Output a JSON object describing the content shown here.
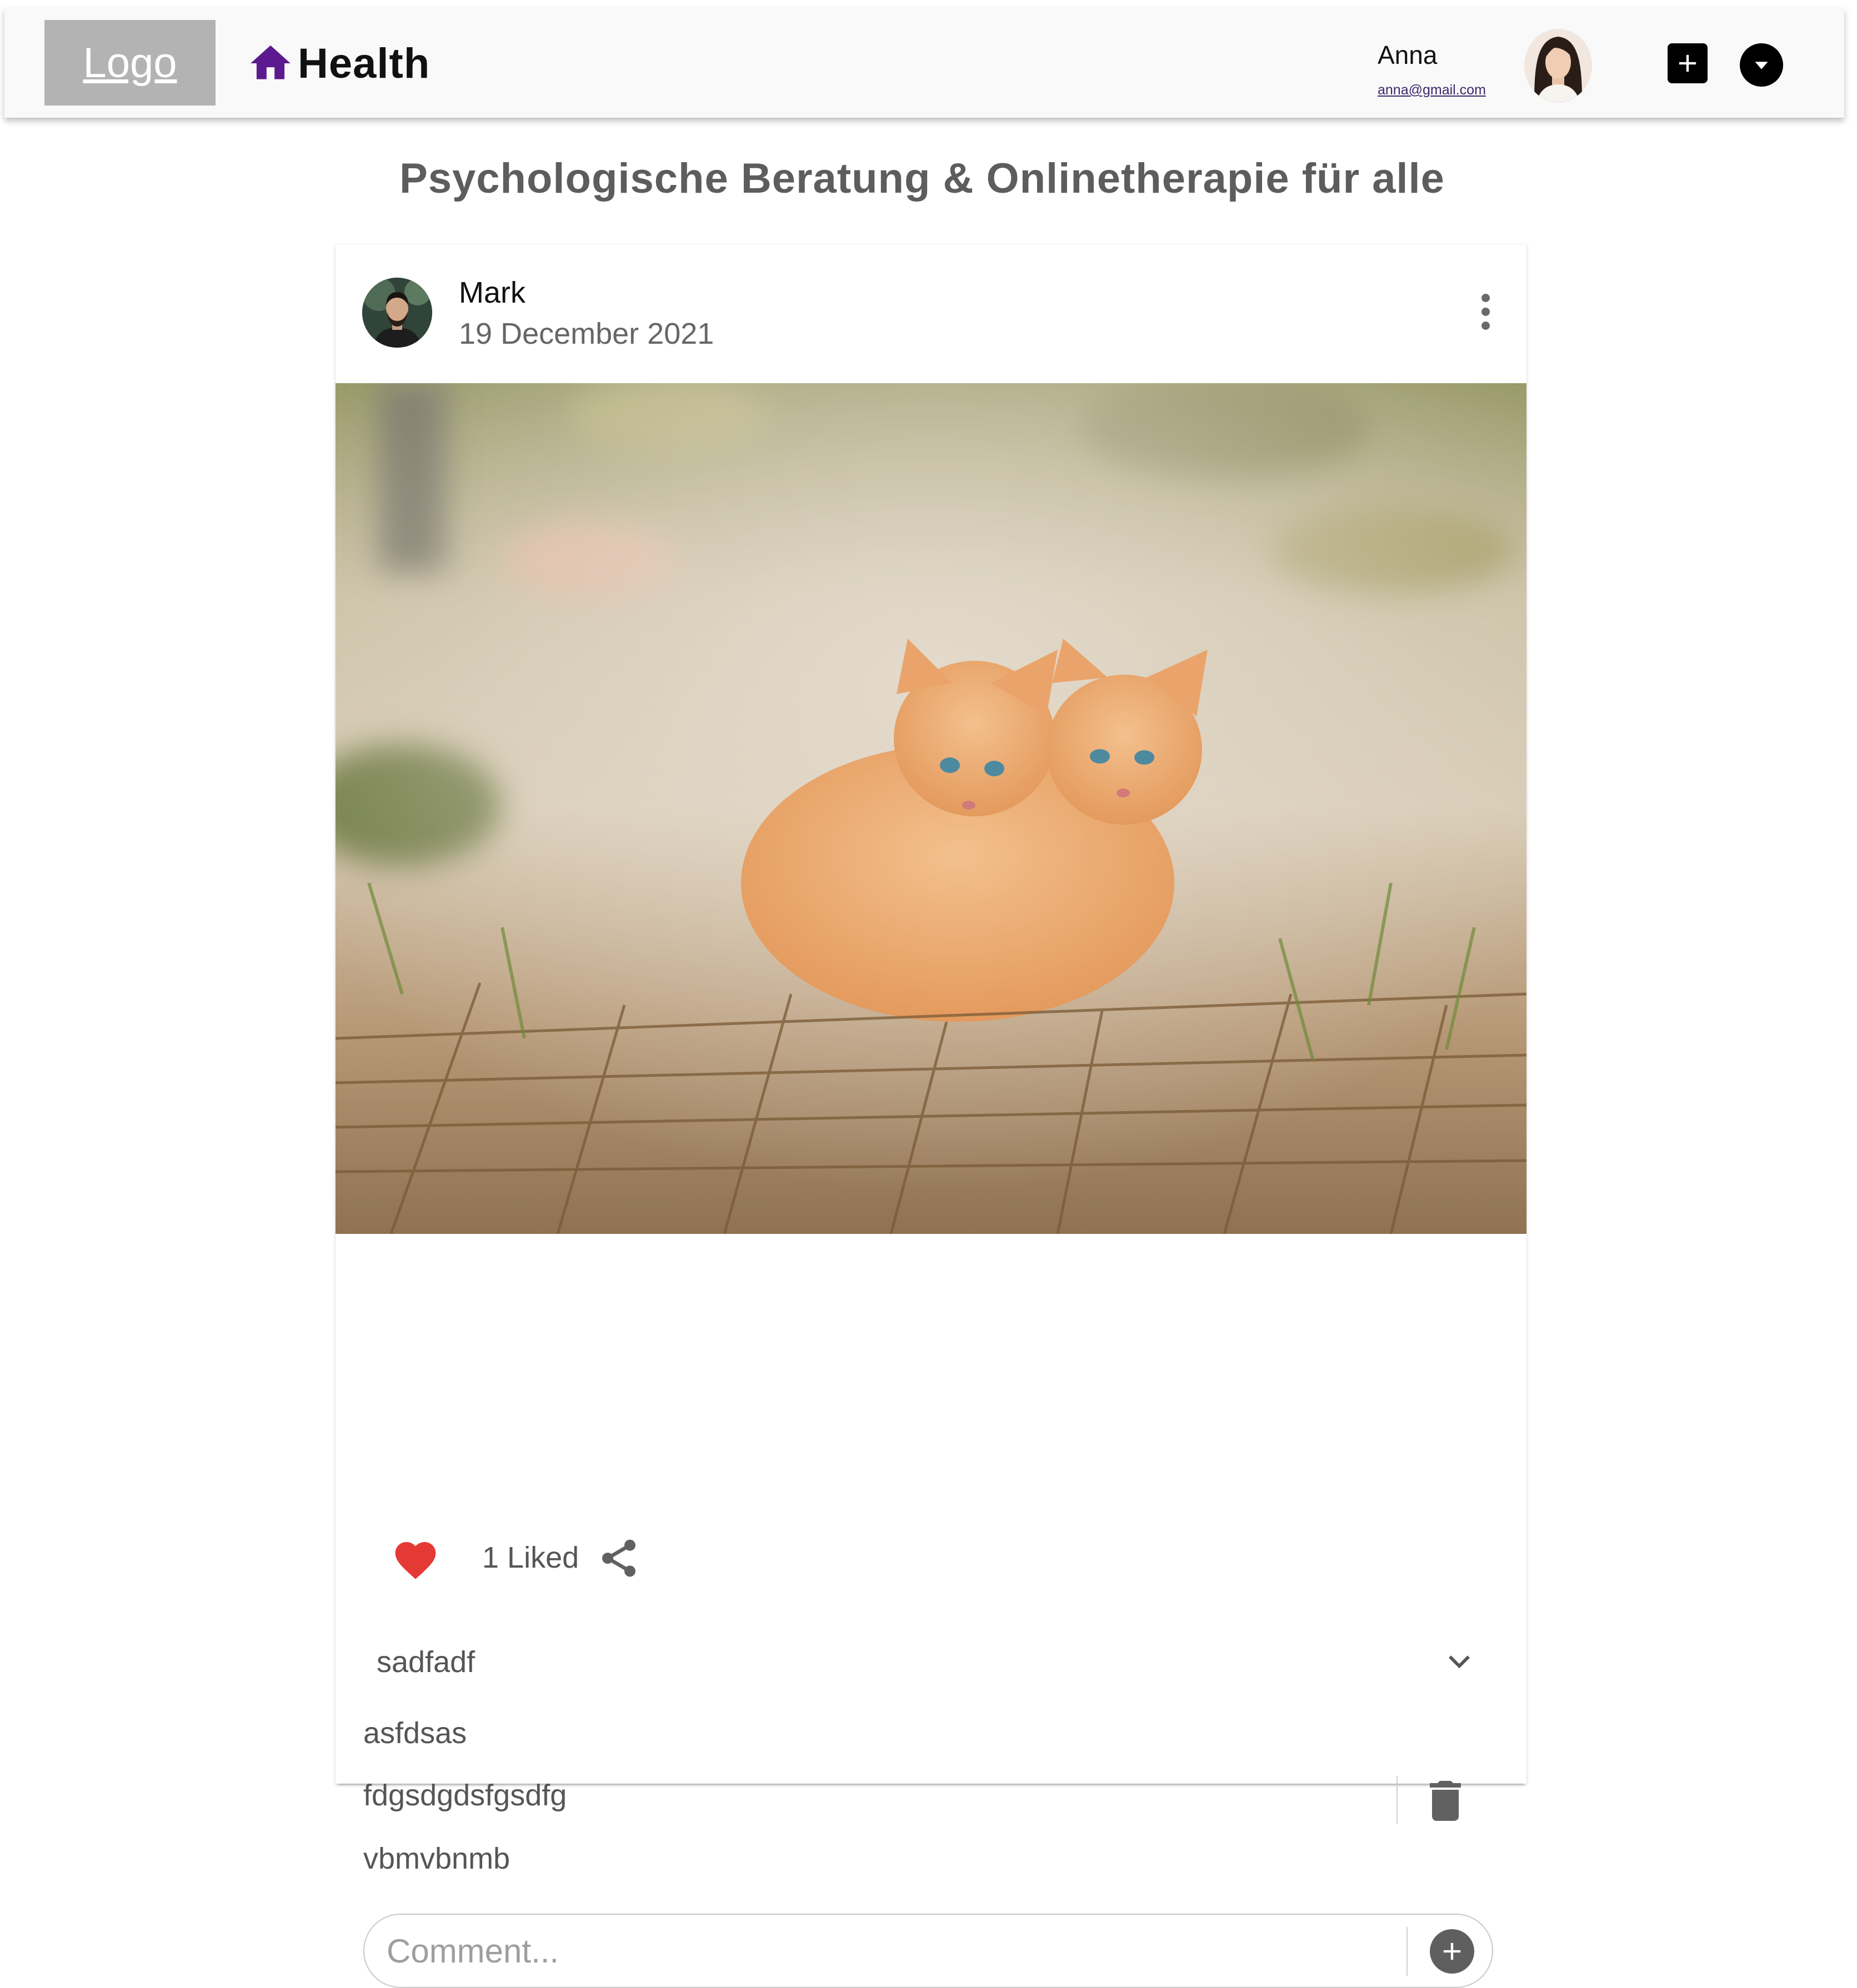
{
  "header": {
    "logo": "Logo",
    "brand": "Health",
    "user": {
      "name": "Anna",
      "email": "anna@gmail.com"
    }
  },
  "page": {
    "title": "Psychologische Beratung & Onlinetherapie für alle"
  },
  "post": {
    "author": "Mark",
    "date": "19 December 2021",
    "likes_label": "1 Liked",
    "comments_header": "sadfadf",
    "comments": [
      "asfdsas",
      "fdgsdgdsfgsdfg",
      "vbmvbnmb"
    ],
    "comment_placeholder": "Comment..."
  },
  "icons": {
    "brand": "home-icon",
    "add": "add-box-icon",
    "menu": "arrow-drop-down-circle-icon",
    "more": "more-vert-icon",
    "like": "heart-icon",
    "share": "share-icon",
    "expand": "chevron-down-icon",
    "delete": "trash-icon",
    "comment_add": "add-circle-icon"
  },
  "colors": {
    "brand_icon": "#5b1a8e",
    "like": "#e53935",
    "logo_bg": "#b3b3b3"
  }
}
